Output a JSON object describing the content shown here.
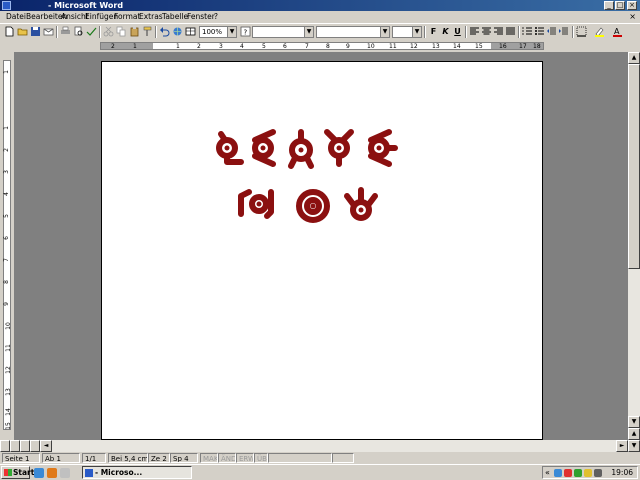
{
  "window": {
    "title": "- Microsoft Word",
    "minimize_glyph": "_",
    "maximize_glyph": "□",
    "close_glyph": "×"
  },
  "menus": [
    "Datei",
    "Bearbeiten",
    "Ansicht",
    "Einfügen",
    "Format",
    "Extras",
    "Tabelle",
    "Fenster",
    "?"
  ],
  "toolbar": {
    "zoom": "100%",
    "style": "",
    "font": "",
    "size": ""
  },
  "format_buttons": {
    "bold": "F",
    "italic": "K",
    "underline": "U"
  },
  "ruler": {
    "h_ticks": [
      "2",
      "1",
      "1",
      "2",
      "3",
      "4",
      "5",
      "6",
      "7",
      "8",
      "9",
      "10",
      "11",
      "12",
      "13",
      "14",
      "15",
      "16",
      "17",
      "18"
    ],
    "v_ticks": [
      "1",
      "1",
      "2",
      "3",
      "4",
      "5",
      "6",
      "7",
      "8",
      "9",
      "10",
      "11",
      "12",
      "13",
      "14",
      "15"
    ]
  },
  "document": {
    "line1": "LEAVE",
    "line2": "NOW",
    "art_color": "#8b1010"
  },
  "statusbar": {
    "page": "Seite 1",
    "section": "Ab 1",
    "pages": "1/1",
    "position": "Bei 5,4 cm",
    "line": "Ze 2",
    "column": "Sp 4",
    "mak": "MAK",
    "and": "ÄND",
    "erw": "ERW",
    "ub": "ÜB"
  },
  "taskbar": {
    "start": "Start",
    "task_word": "- Microso...",
    "clock": "19:06",
    "tray_arrow": "«"
  }
}
